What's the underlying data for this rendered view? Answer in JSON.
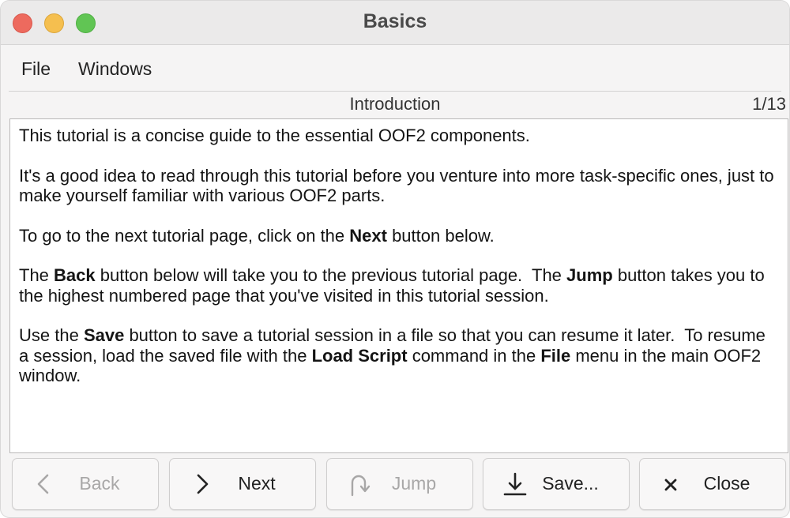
{
  "window": {
    "title": "Basics"
  },
  "menubar": {
    "file": "File",
    "windows": "Windows"
  },
  "section": {
    "title": "Introduction",
    "page_indicator": "1/13"
  },
  "content": {
    "p1": "This tutorial is a concise guide to the essential OOF2 components.",
    "p2": "It's a good idea to read through this tutorial before you venture into more task-specific ones, just to make yourself familiar with various OOF2 parts.",
    "p3": {
      "a": "To go to the next tutorial page, click on the ",
      "b": "Next",
      "c": " button below."
    },
    "p4": {
      "a": "The ",
      "b": "Back",
      "c": " button below will take you to the previous tutorial page.  The ",
      "d": "Jump",
      "e": " button takes you to the highest numbered page that you've visited in this tutorial session."
    },
    "p5": {
      "a": "Use the ",
      "b": "Save",
      "c": " button to save a tutorial session in a file so that you can resume it later.  To resume a session, load the saved file with the ",
      "d": "Load Script",
      "e": " command in the ",
      "f": "File",
      "g": " menu in the main OOF2 window."
    }
  },
  "buttons": {
    "back": "Back",
    "next": "Next",
    "jump": "Jump",
    "save": "Save...",
    "close": "Close"
  },
  "icons": {
    "back": "chevron-left-icon",
    "next": "chevron-right-icon",
    "jump": "redo-arrow-icon",
    "save": "download-icon",
    "close": "x-icon"
  },
  "colors": {
    "traffic_close": "#ed6a5e",
    "traffic_minimize": "#f5bf4f",
    "traffic_zoom": "#61c554",
    "disabled_text": "#a8a7a7"
  }
}
